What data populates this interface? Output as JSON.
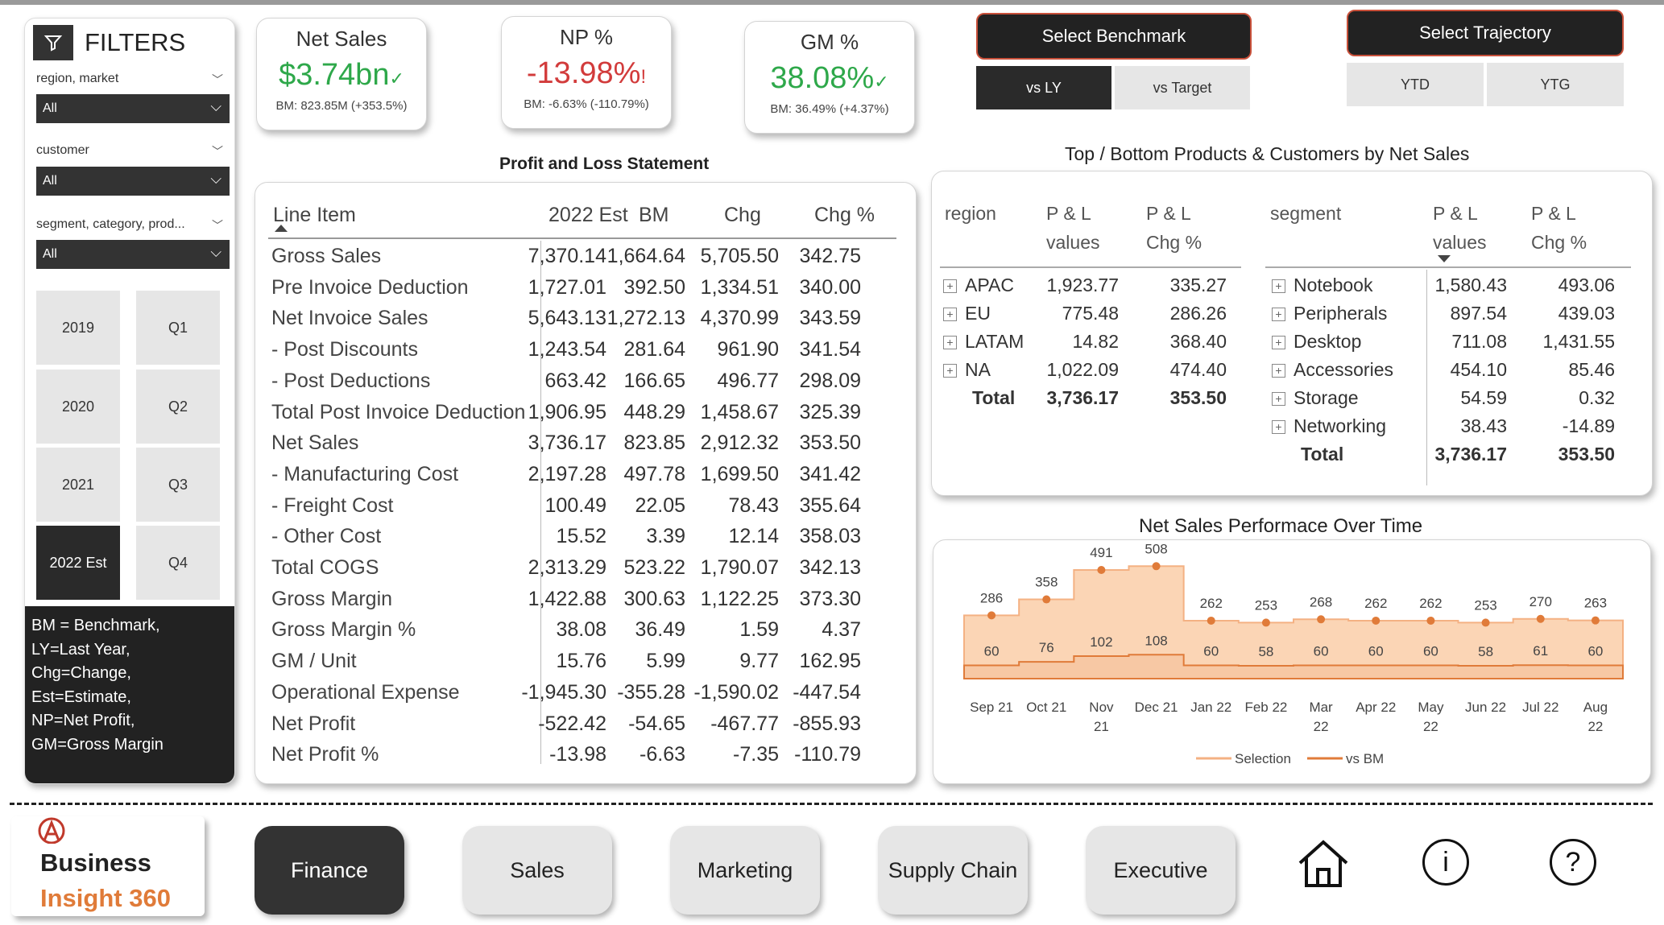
{
  "filters": {
    "title": "FILTERS",
    "groups": [
      {
        "label": "region, market",
        "value": "All"
      },
      {
        "label": "customer",
        "value": "All"
      },
      {
        "label": "segment, category, prod...",
        "value": "All"
      }
    ],
    "years": [
      "2019",
      "2020",
      "2021",
      "2022 Est"
    ],
    "quarters": [
      "Q1",
      "Q2",
      "Q3",
      "Q4"
    ],
    "selected_year": "2022 Est",
    "legend": [
      "BM = Benchmark,",
      "LY=Last Year,",
      "Chg=Change,",
      "Est=Estimate,",
      "NP=Net Profit,",
      "GM=Gross Margin"
    ]
  },
  "kpis": [
    {
      "title": "Net Sales",
      "value": "$3.74bn",
      "indicator": "✓",
      "bm": "BM: 823.85M (+353.5%)",
      "status": "good"
    },
    {
      "title": "NP %",
      "value": "-13.98%",
      "indicator": "!",
      "bm": "BM: -6.63% (-110.79%)",
      "status": "bad"
    },
    {
      "title": "GM %",
      "value": "38.08%",
      "indicator": "✓",
      "bm": "BM: 36.49% (+4.37%)",
      "status": "good"
    }
  ],
  "benchmark": {
    "title": "Select Benchmark",
    "options": [
      "vs LY",
      "vs Target"
    ],
    "selected": "vs LY"
  },
  "trajectory": {
    "title": "Select Trajectory",
    "options": [
      "YTD",
      "YTG"
    ]
  },
  "pl": {
    "title": "Profit and Loss Statement",
    "headers": [
      "Line Item",
      "2022 Est",
      "BM",
      "Chg",
      "Chg %"
    ],
    "rows": [
      [
        "Gross Sales",
        "7,370.14",
        "1,664.64",
        "5,705.50",
        "342.75"
      ],
      [
        "Pre Invoice Deduction",
        "1,727.01",
        "392.50",
        "1,334.51",
        "340.00"
      ],
      [
        "Net Invoice Sales",
        "5,643.13",
        "1,272.13",
        "4,370.99",
        "343.59"
      ],
      [
        "- Post Discounts",
        "1,243.54",
        "281.64",
        "961.90",
        "341.54"
      ],
      [
        "- Post Deductions",
        "663.42",
        "166.65",
        "496.77",
        "298.09"
      ],
      [
        "Total Post Invoice Deduction",
        "1,906.95",
        "448.29",
        "1,458.67",
        "325.39"
      ],
      [
        "Net Sales",
        "3,736.17",
        "823.85",
        "2,912.32",
        "353.50"
      ],
      [
        "- Manufacturing Cost",
        "2,197.28",
        "497.78",
        "1,699.50",
        "341.42"
      ],
      [
        "- Freight Cost",
        "100.49",
        "22.05",
        "78.43",
        "355.64"
      ],
      [
        "- Other Cost",
        "15.52",
        "3.39",
        "12.14",
        "358.03"
      ],
      [
        "Total COGS",
        "2,313.29",
        "523.22",
        "1,790.07",
        "342.13"
      ],
      [
        "Gross Margin",
        "1,422.88",
        "300.63",
        "1,122.25",
        "373.30"
      ],
      [
        "Gross Margin %",
        "38.08",
        "36.49",
        "1.59",
        "4.37"
      ],
      [
        "GM / Unit",
        "15.76",
        "5.99",
        "9.77",
        "162.95"
      ],
      [
        "Operational Expense",
        "-1,945.30",
        "-355.28",
        "-1,590.02",
        "-447.54"
      ],
      [
        "Net Profit",
        "-522.42",
        "-54.65",
        "-467.77",
        "-855.93"
      ],
      [
        "Net Profit %",
        "-13.98",
        "-6.63",
        "-7.35",
        "-110.79"
      ]
    ]
  },
  "topbottom": {
    "title": "Top / Bottom Products & Customers by Net Sales",
    "region_table": {
      "headers": [
        "region",
        "P & L values",
        "P & L Chg %"
      ],
      "rows": [
        [
          "APAC",
          "1,923.77",
          "335.27"
        ],
        [
          "EU",
          "775.48",
          "286.26"
        ],
        [
          "LATAM",
          "14.82",
          "368.40"
        ],
        [
          "NA",
          "1,022.09",
          "474.40"
        ]
      ],
      "total": [
        "Total",
        "3,736.17",
        "353.50"
      ]
    },
    "segment_table": {
      "headers": [
        "segment",
        "P & L values",
        "P & L Chg %"
      ],
      "rows": [
        [
          "Notebook",
          "1,580.43",
          "493.06"
        ],
        [
          "Peripherals",
          "897.54",
          "439.03"
        ],
        [
          "Desktop",
          "711.08",
          "1,431.55"
        ],
        [
          "Accessories",
          "454.10",
          "85.46"
        ],
        [
          "Storage",
          "54.59",
          "0.32"
        ],
        [
          "Networking",
          "38.43",
          "-14.89"
        ]
      ],
      "total": [
        "Total",
        "3,736.17",
        "353.50"
      ]
    }
  },
  "chart_data": {
    "type": "area",
    "title": "Net Sales Performace Over Time",
    "categories": [
      "Sep 21",
      "Oct 21",
      "Nov 21",
      "Dec 21",
      "Jan 22",
      "Feb 22",
      "Mar 22",
      "Apr 22",
      "May 22",
      "Jun 22",
      "Jul 22",
      "Aug 22"
    ],
    "series": [
      {
        "name": "Selection",
        "values": [
          286,
          358,
          491,
          508,
          262,
          253,
          268,
          262,
          262,
          253,
          270,
          263
        ],
        "color": "#f4b183"
      },
      {
        "name": "vs BM",
        "values": [
          60,
          76,
          102,
          108,
          60,
          58,
          60,
          60,
          60,
          58,
          61,
          60
        ],
        "color": "#e07b39"
      }
    ],
    "ylim": [
      0,
      560
    ],
    "legend_position": "bottom",
    "grid": false
  },
  "footer": {
    "brand_line1": "Business",
    "brand_line2": "Insight 360",
    "nav": [
      "Finance",
      "Sales",
      "Marketing",
      "Supply Chain",
      "Executive"
    ],
    "selected": "Finance"
  }
}
